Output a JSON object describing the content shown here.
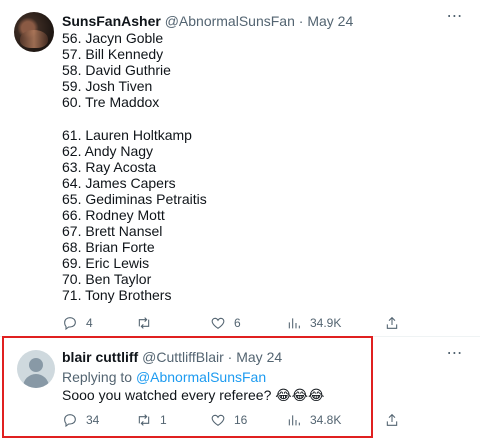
{
  "tweet1": {
    "display_name": "SunsFanAsher",
    "handle": "@AbnormalSunsFan",
    "separator": "·",
    "date": "May 24",
    "lines_a": [
      "56. Jacyn Goble",
      "57. Bill Kennedy",
      "58. David Guthrie",
      "59. Josh Tiven",
      "60. Tre Maddox"
    ],
    "lines_b": [
      "61. Lauren Holtkamp",
      "62. Andy Nagy",
      "63. Ray Acosta",
      "64. James Capers",
      "65. Gediminas Petraitis",
      "66. Rodney Mott",
      "67. Brett Nansel",
      "68. Brian Forte",
      "69. Eric Lewis",
      "70. Ben Taylor",
      "71. Tony Brothers"
    ],
    "replies": "4",
    "retweets": "",
    "likes": "6",
    "views": "34.9K"
  },
  "tweet2": {
    "display_name": "blair cuttliff",
    "handle": "@CuttliffBlair",
    "separator": "·",
    "date": "May 24",
    "replying_to_prefix": "Replying to ",
    "replying_to_handle": "@AbnormalSunsFan",
    "text": "Sooo you watched every referee? 😂😂😂",
    "replies": "34",
    "retweets": "1",
    "likes": "16",
    "views": "34.8K"
  },
  "more_icon": "⋯",
  "colors": {
    "secondary_text": "#536471",
    "link": "#1d9bf0",
    "highlight": "#e02020"
  }
}
